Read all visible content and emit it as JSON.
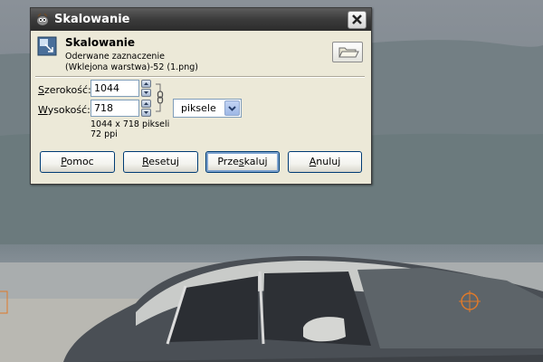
{
  "window": {
    "title": "Skalowanie",
    "close_icon": "close-icon"
  },
  "header": {
    "title": "Skalowanie",
    "subtitle": "Oderwane zaznaczenie",
    "layer": "(Wklejona warstwa)-52 (1.png)",
    "icon": "scale-layer-icon",
    "folder_icon": "open-folder-icon"
  },
  "size": {
    "width_label_key": "S",
    "width_label_rest": "zerokość:",
    "width_value": "1044",
    "height_label_key": "W",
    "height_label_rest": "ysokość:",
    "height_value": "718",
    "chain_icon": "chain-link-icon",
    "unit": "piksele",
    "dimensions_text": "1044 x 718 pikseli",
    "resolution_text": "72 ppi"
  },
  "buttons": {
    "help_key": "P",
    "help_rest": "omoc",
    "reset_key": "R",
    "reset_rest": "esetuj",
    "scale_pre": "Prze",
    "scale_key": "s",
    "scale_post": "kaluj",
    "cancel_key": "A",
    "cancel_rest": "nuluj"
  },
  "colors": {
    "titlebar": "#3b3b3b",
    "dialog_bg": "#ece9d8",
    "button_border": "#003c74"
  }
}
